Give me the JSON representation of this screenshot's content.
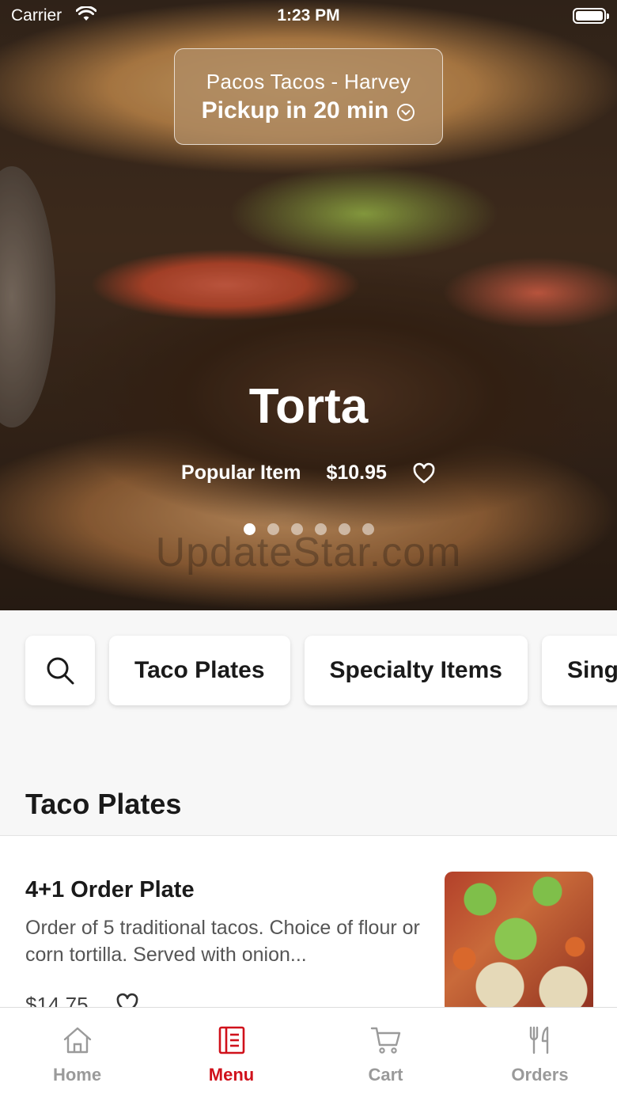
{
  "status_bar": {
    "carrier": "Carrier",
    "time": "1:23 PM"
  },
  "location": {
    "name": "Pacos Tacos - Harvey",
    "pickup": "Pickup in 20 min"
  },
  "featured": {
    "name": "Torta",
    "badge": "Popular Item",
    "price": "$10.95",
    "slide_count": 6,
    "active_slide": 1,
    "watermark": "UpdateStar.com"
  },
  "categories": [
    "Taco Plates",
    "Specialty Items",
    "Sing"
  ],
  "section": {
    "title": "Taco Plates"
  },
  "items": [
    {
      "name": "4+1 Order Plate",
      "description": "Order of 5 traditional tacos. Choice of flour or corn tortilla. Served with onion...",
      "price": "$14.75"
    }
  ],
  "tabs": [
    {
      "label": "Home",
      "icon": "home-icon",
      "active": false
    },
    {
      "label": "Menu",
      "icon": "menu-icon",
      "active": true
    },
    {
      "label": "Cart",
      "icon": "cart-icon",
      "active": false
    },
    {
      "label": "Orders",
      "icon": "utensils-icon",
      "active": false
    }
  ],
  "colors": {
    "accent": "#d0111b",
    "tab_inactive": "#9a9a9a",
    "pill_bg": "#b08c64"
  }
}
